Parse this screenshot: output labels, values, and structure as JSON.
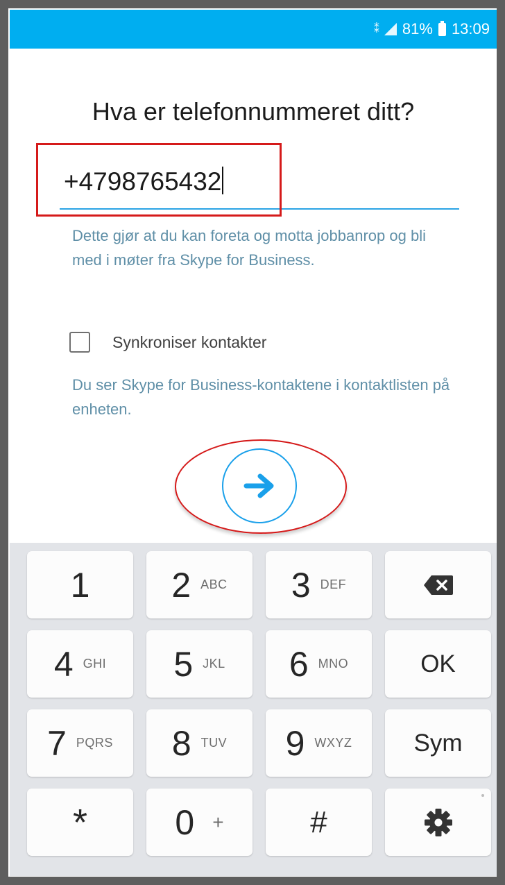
{
  "status_bar": {
    "battery": "81%",
    "time": "13:09",
    "icons": [
      "wifi-calling-icon",
      "signal-icon",
      "battery-icon"
    ]
  },
  "main": {
    "question": "Hva er telefonnummeret ditt?",
    "phone_input": {
      "value": "+4798765432"
    },
    "helper_text": "Dette gjør at du kan foreta og motta jobbanrop og bli med i møter fra Skype for Business.",
    "sync_checkbox": {
      "label": "Synkroniser kontakter",
      "checked": false
    },
    "sync_note": "Du ser Skype for Business-kontaktene i kontaktlisten på enheten.",
    "next_button": {
      "icon": "arrow-right-icon"
    }
  },
  "annotations": {
    "highlight_color": "#d51a1a"
  },
  "keypad": {
    "keys": [
      {
        "main": "1",
        "sub": ""
      },
      {
        "main": "2",
        "sub": "ABC"
      },
      {
        "main": "3",
        "sub": "DEF"
      },
      {
        "main": "",
        "sub": "",
        "icon": "backspace-icon"
      },
      {
        "main": "4",
        "sub": "GHI"
      },
      {
        "main": "5",
        "sub": "JKL"
      },
      {
        "main": "6",
        "sub": "MNO"
      },
      {
        "main": "OK",
        "sub": ""
      },
      {
        "main": "7",
        "sub": "PQRS"
      },
      {
        "main": "8",
        "sub": "TUV"
      },
      {
        "main": "9",
        "sub": "WXYZ"
      },
      {
        "main": "Sym",
        "sub": ""
      },
      {
        "main": "*",
        "sub": ""
      },
      {
        "main": "0",
        "sub": "+"
      },
      {
        "main": "#",
        "sub": ""
      },
      {
        "main": "",
        "sub": "",
        "icon": "settings-icon"
      }
    ]
  },
  "colors": {
    "accent": "#00aef0",
    "helper_text": "#5f8fa7",
    "input_underline": "#2aa3e5",
    "keypad_bg": "#e2e4e8"
  }
}
